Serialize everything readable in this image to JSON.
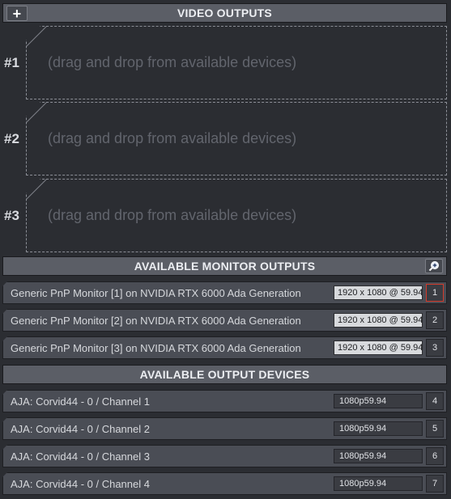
{
  "video_outputs": {
    "title": "VIDEO OUTPUTS",
    "add_label": "+",
    "slots": [
      {
        "label": "#1",
        "hint": "(drag and drop from available devices)"
      },
      {
        "label": "#2",
        "hint": "(drag and drop from available devices)"
      },
      {
        "label": "#3",
        "hint": "(drag and drop from available devices)"
      }
    ]
  },
  "monitor_outputs": {
    "title": "AVAILABLE MONITOR OUTPUTS",
    "zoom_icon": "zoom-plus-icon",
    "items": [
      {
        "name": "Generic PnP Monitor [1] on NVIDIA RTX 6000 Ada Generation",
        "resolution": "1920 x 1080 @ 59.94",
        "index": "1"
      },
      {
        "name": "Generic PnP Monitor [2] on NVIDIA RTX 6000 Ada Generation",
        "resolution": "1920 x 1080 @ 59.94",
        "index": "2"
      },
      {
        "name": "Generic PnP Monitor [3] on NVIDIA RTX 6000 Ada Generation",
        "resolution": "1920 x 1080 @ 59.94",
        "index": "3"
      }
    ]
  },
  "output_devices": {
    "title": "AVAILABLE OUTPUT DEVICES",
    "items": [
      {
        "name": "AJA: Corvid44 - 0 / Channel 1",
        "format": "1080p59.94",
        "index": "4"
      },
      {
        "name": "AJA: Corvid44 - 0 / Channel 2",
        "format": "1080p59.94",
        "index": "5"
      },
      {
        "name": "AJA: Corvid44 - 0 / Channel 3",
        "format": "1080p59.94",
        "index": "6"
      },
      {
        "name": "AJA: Corvid44 - 0 / Channel 4",
        "format": "1080p59.94",
        "index": "7"
      }
    ]
  },
  "colors": {
    "background": "#2b2d32",
    "header": "#5b5e66",
    "row": "#4a4d55",
    "selected_border": "#d23a2a"
  }
}
